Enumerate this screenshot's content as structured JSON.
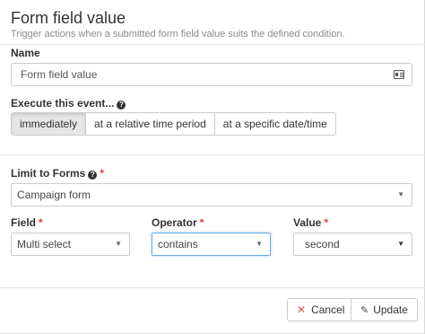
{
  "header": {
    "title": "Form field value",
    "subtitle": "Trigger actions when a submitted form field value suits the defined condition."
  },
  "name": {
    "label": "Name",
    "value": "Form field value"
  },
  "execute": {
    "label": "Execute this event...",
    "options": [
      "immediately",
      "at a relative time period",
      "at a specific date/time"
    ],
    "selected": "immediately"
  },
  "limit_forms": {
    "label": "Limit to Forms",
    "required_mark": "*",
    "value": "Campaign form"
  },
  "field": {
    "label": "Field",
    "required_mark": "*",
    "value": "Multi select"
  },
  "operator": {
    "label": "Operator",
    "required_mark": "*",
    "value": "contains"
  },
  "value": {
    "label": "Value",
    "required_mark": "*",
    "value": "second"
  },
  "footer": {
    "cancel_label": "Cancel",
    "update_label": "Update"
  },
  "icons": {
    "help": "question-circle-icon",
    "card": "id-card-icon",
    "cancel": "close-icon",
    "update": "pencil-icon"
  },
  "colors": {
    "required": "#e03c31",
    "cancel_icon": "#d9534f",
    "focus_border": "#66afe9",
    "active_segment": "#e6e6e6"
  }
}
